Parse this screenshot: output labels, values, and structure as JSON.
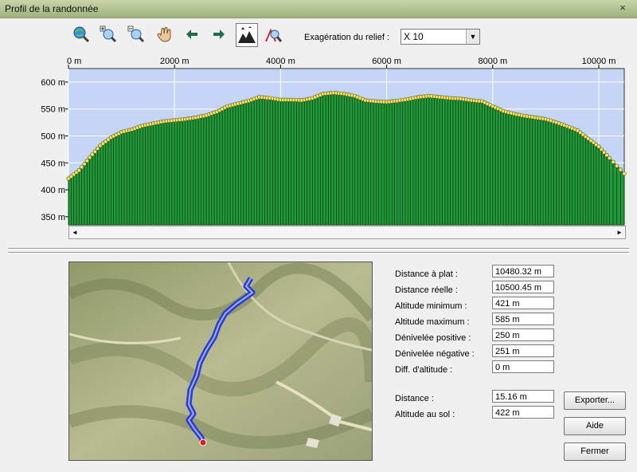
{
  "window": {
    "title": "Profil de la randonnée",
    "close_glyph": "×"
  },
  "toolbar": {
    "tools": [
      "zoom-globe-icon",
      "zoom-in-icon",
      "zoom-out-icon",
      "pan-hand-icon",
      "arrow-left-icon",
      "arrow-right-icon",
      "relief-mountain-icon",
      "zoom-profile-icon"
    ],
    "exaggeration_label": "Exagération du relief :",
    "exaggeration_value": "X 10"
  },
  "chart_data": {
    "type": "area",
    "xlabel": "",
    "ylabel": "",
    "x_unit": "m",
    "x_ticks": [
      "0 m",
      "2000 m",
      "4000 m",
      "6000 m",
      "8000 m",
      "10000 m"
    ],
    "y_ticks": [
      "350 m",
      "400 m",
      "450 m",
      "500 m",
      "550 m",
      "600 m"
    ],
    "xlim": [
      0,
      10480
    ],
    "ylim": [
      335,
      625
    ],
    "grid": true,
    "colors": {
      "fill": "#239a3a",
      "sky": "#c4d5f5",
      "point": "#f2e266"
    },
    "x": [
      0,
      200,
      400,
      600,
      800,
      1000,
      1200,
      1400,
      1600,
      1800,
      2000,
      2200,
      2400,
      2600,
      2800,
      3000,
      3200,
      3400,
      3600,
      3800,
      4000,
      4200,
      4400,
      4600,
      4800,
      5000,
      5200,
      5400,
      5600,
      5800,
      6000,
      6200,
      6400,
      6600,
      6800,
      7000,
      7200,
      7400,
      7600,
      7800,
      8000,
      8200,
      8400,
      8600,
      8800,
      9000,
      9200,
      9400,
      9600,
      9800,
      10000,
      10200,
      10480
    ],
    "y": [
      421,
      436,
      460,
      482,
      497,
      507,
      512,
      519,
      523,
      527,
      529,
      531,
      534,
      538,
      545,
      555,
      560,
      565,
      572,
      570,
      567,
      567,
      566,
      570,
      578,
      580,
      578,
      574,
      566,
      564,
      563,
      565,
      568,
      572,
      574,
      572,
      570,
      569,
      566,
      564,
      555,
      546,
      541,
      537,
      534,
      531,
      525,
      518,
      510,
      495,
      480,
      459,
      430
    ]
  },
  "stats": [
    {
      "label": "Distance à plat :",
      "value": "10480.32 m"
    },
    {
      "label": "Distance réelle :",
      "value": "10500.45 m"
    },
    {
      "label": "Altitude minimum :",
      "value": "421 m"
    },
    {
      "label": "Altitude maximum :",
      "value": "585 m"
    },
    {
      "label": "Dénivelée positive :",
      "value": "250 m"
    },
    {
      "label": "Dénivelée négative :",
      "value": "251 m"
    },
    {
      "label": "Diff. d'altitude :",
      "value": "0 m"
    }
  ],
  "cursor": [
    {
      "label": "Distance :",
      "value": "15.16 m"
    },
    {
      "label": "Altitude au sol :",
      "value": "422 m"
    }
  ],
  "buttons": {
    "export": "Exporter...",
    "help": "Aide",
    "close": "Fermer"
  },
  "scroll": {
    "left": "◄",
    "right": "►"
  }
}
